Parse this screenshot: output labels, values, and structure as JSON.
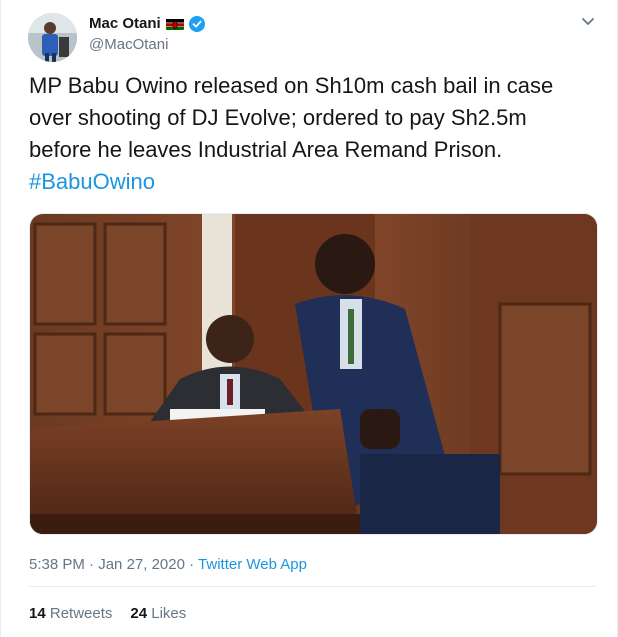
{
  "user": {
    "display_name": "Mac Otani",
    "handle": "@MacOtani",
    "verified": true,
    "flag": "Kenya"
  },
  "tweet": {
    "text": "MP Babu Owino released on Sh10m cash bail in case over shooting of DJ Evolve; ordered to pay Sh2.5m before he leaves Industrial Area Remand Prison.",
    "hashtag": "#BabuOwino"
  },
  "meta": {
    "time": "5:38 PM",
    "separator1": " · ",
    "date": "Jan 27, 2020",
    "separator2": " · ",
    "source": "Twitter Web App"
  },
  "stats": {
    "retweets_count": "14",
    "retweets_label": "Retweets",
    "likes_count": "24",
    "likes_label": "Likes"
  },
  "colors": {
    "link": "#1b95e0",
    "muted": "#657786",
    "text": "#14171a",
    "border": "#e6ecf0"
  },
  "icons": {
    "verified": "verified-badge-icon",
    "more": "chevron-down-icon",
    "flag": "kenya-flag-icon"
  }
}
